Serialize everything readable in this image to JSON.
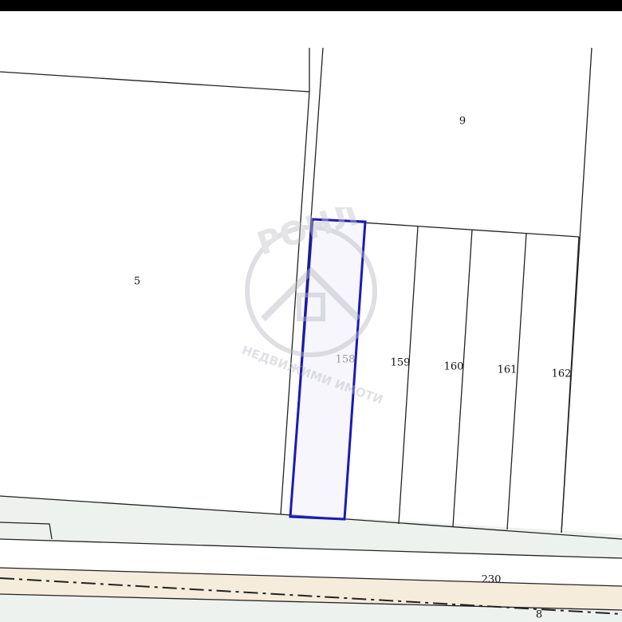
{
  "map": {
    "parcels": [
      {
        "id": "parcel-5",
        "label": "5"
      },
      {
        "id": "parcel-9",
        "label": "9"
      },
      {
        "id": "parcel-158",
        "label": "158",
        "selected": true
      },
      {
        "id": "parcel-159",
        "label": "159"
      },
      {
        "id": "parcel-160",
        "label": "160"
      },
      {
        "id": "parcel-161",
        "label": "161"
      },
      {
        "id": "parcel-162",
        "label": "162"
      },
      {
        "id": "parcel-230",
        "label": "230"
      },
      {
        "id": "parcel-8",
        "label": "8"
      }
    ],
    "watermark": {
      "brand": "РОНЛ",
      "tagline": "НЕДВИЖИМИ ИМОТИ"
    },
    "colors": {
      "selected_outline": "#1a1ab8",
      "road_fill": "#f6ecdc",
      "strip_fill": "#eef2ee",
      "line": "#222222"
    }
  }
}
